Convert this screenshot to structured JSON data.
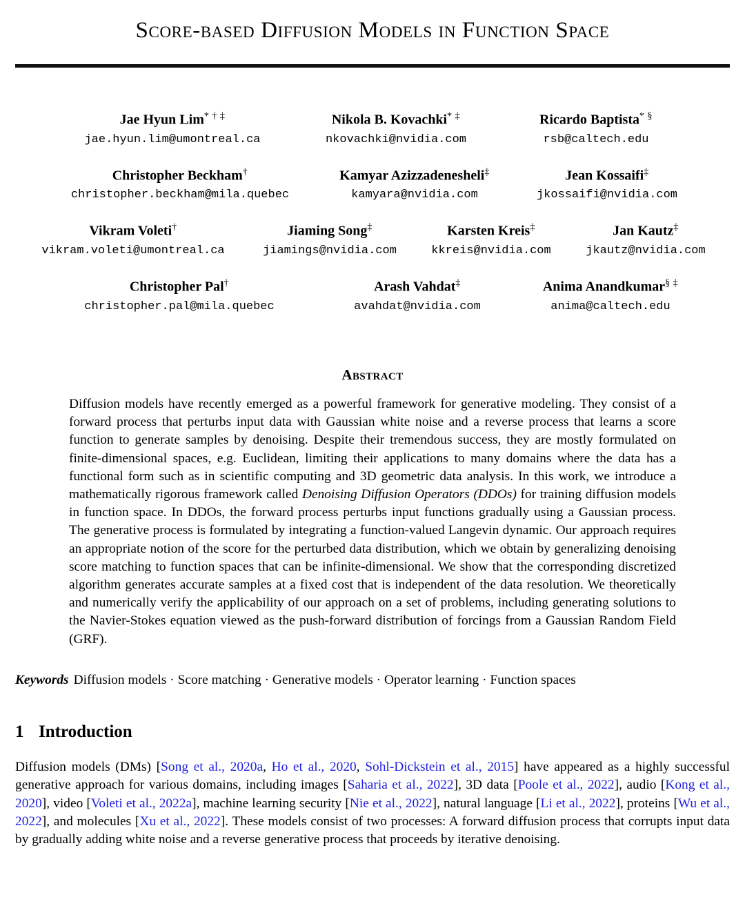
{
  "title": "Score-based Diffusion Models in Function Space",
  "authors": {
    "rows": [
      [
        {
          "name": "Jae Hyun Lim",
          "marks": "* † ‡",
          "email": "jae.hyun.lim@umontreal.ca"
        },
        {
          "name": "Nikola B. Kovachki",
          "marks": "* ‡",
          "email": "nkovachki@nvidia.com"
        },
        {
          "name": "Ricardo Baptista",
          "marks": "* §",
          "email": "rsb@caltech.edu"
        }
      ],
      [
        {
          "name": "Christopher Beckham",
          "marks": "†",
          "email": "christopher.beckham@mila.quebec"
        },
        {
          "name": "Kamyar Azizzadenesheli",
          "marks": "‡",
          "email": "kamyara@nvidia.com"
        },
        {
          "name": "Jean Kossaifi",
          "marks": "‡",
          "email": "jkossaifi@nvidia.com"
        }
      ],
      [
        {
          "name": "Vikram Voleti",
          "marks": "†",
          "email": "vikram.voleti@umontreal.ca"
        },
        {
          "name": "Jiaming Song",
          "marks": "‡",
          "email": "jiamings@nvidia.com"
        },
        {
          "name": "Karsten Kreis",
          "marks": "‡",
          "email": "kkreis@nvidia.com"
        },
        {
          "name": "Jan Kautz",
          "marks": "‡",
          "email": "jkautz@nvidia.com"
        }
      ],
      [
        {
          "name": "Christopher Pal",
          "marks": "†",
          "email": "christopher.pal@mila.quebec"
        },
        {
          "name": "Arash Vahdat",
          "marks": "‡",
          "email": "avahdat@nvidia.com"
        },
        {
          "name": "Anima Anandkumar",
          "marks": "§ ‡",
          "email": "anima@caltech.edu"
        }
      ]
    ]
  },
  "abstract": {
    "heading": "Abstract",
    "part1": "Diffusion models have recently emerged as a powerful framework for generative modeling. They consist of a forward process that perturbs input data with Gaussian white noise and a reverse process that learns a score function to generate samples by denoising. Despite their tremendous success, they are mostly formulated on finite-dimensional spaces, e.g. Euclidean, limiting their applications to many domains where the data has a functional form such as in scientific computing and 3D geometric data analysis. In this work, we introduce a mathematically rigorous framework called ",
    "italic_term": "Denoising Diffusion Operators (DDOs)",
    "part2": " for training diffusion models in function space. In DDOs, the forward process perturbs input functions gradually using a Gaussian process. The generative process is formulated by integrating a function-valued Langevin dynamic. Our approach requires an appropriate notion of the score for the perturbed data distribution, which we obtain by generalizing denoising score matching to function spaces that can be infinite-dimensional. We show that the corresponding discretized algorithm generates accurate samples at a fixed cost that is independent of the data resolution. We theoretically and numerically verify the applicability of our approach on a set of problems, including generating solutions to the Navier-Stokes equation viewed as the push-forward distribution of forcings from a Gaussian Random Field (GRF)."
  },
  "keywords": {
    "label": "Keywords",
    "terms": [
      "Diffusion models",
      "Score matching",
      "Generative models",
      "Operator learning",
      "Function spaces"
    ],
    "separator": " · "
  },
  "section": {
    "number": "1",
    "heading": "Introduction"
  },
  "intro": {
    "segments": [
      {
        "text": "Diffusion models (DMs) [",
        "cite": false
      },
      {
        "text": "Song et al., 2020a",
        "cite": true
      },
      {
        "text": ", ",
        "cite": false
      },
      {
        "text": "Ho et al., 2020",
        "cite": true
      },
      {
        "text": ", ",
        "cite": false
      },
      {
        "text": "Sohl-Dickstein et al., 2015",
        "cite": true
      },
      {
        "text": "] have appeared as a highly successful generative approach for various domains, including images [",
        "cite": false
      },
      {
        "text": "Saharia et al., 2022",
        "cite": true
      },
      {
        "text": "], 3D data [",
        "cite": false
      },
      {
        "text": "Poole et al., 2022",
        "cite": true
      },
      {
        "text": "], audio [",
        "cite": false
      },
      {
        "text": "Kong et al., 2020",
        "cite": true
      },
      {
        "text": "], video [",
        "cite": false
      },
      {
        "text": "Voleti et al., 2022a",
        "cite": true
      },
      {
        "text": "], machine learning security [",
        "cite": false
      },
      {
        "text": "Nie et al., 2022",
        "cite": true
      },
      {
        "text": "], natural language [",
        "cite": false
      },
      {
        "text": "Li et al., 2022",
        "cite": true
      },
      {
        "text": "], proteins [",
        "cite": false
      },
      {
        "text": "Wu et al., 2022",
        "cite": true
      },
      {
        "text": "], and molecules [",
        "cite": false
      },
      {
        "text": "Xu et al., 2022",
        "cite": true
      },
      {
        "text": "]. These models consist of two processes: A forward diffusion process that corrupts input data by gradually adding white noise and a reverse generative process that proceeds by iterative denoising.",
        "cite": false
      }
    ]
  },
  "colors": {
    "citation_link": "#2020E0",
    "text": "#000000",
    "rule": "#111111"
  }
}
